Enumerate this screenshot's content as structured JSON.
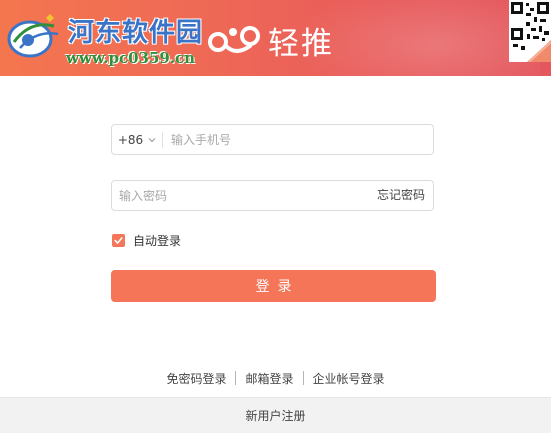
{
  "header": {
    "watermark_title": "河东软件园",
    "watermark_url": "www.pc0359.cn",
    "brand_name": "轻推",
    "brand_color": "#ef6a55",
    "qr_icon": "qr-code-icon"
  },
  "form": {
    "country_code": "+86",
    "phone_placeholder": "输入手机号",
    "password_placeholder": "输入密码",
    "forgot_password": "忘记密码",
    "auto_login_label": "自动登录",
    "auto_login_checked": true,
    "login_button": "登录",
    "accent_color": "#f47557"
  },
  "alt_logins": {
    "items": [
      "免密码登录",
      "邮箱登录",
      "企业帐号登录"
    ]
  },
  "footer": {
    "register_label": "新用户注册"
  }
}
